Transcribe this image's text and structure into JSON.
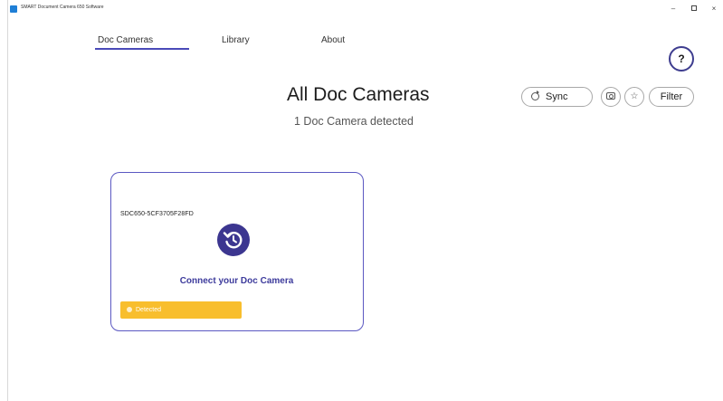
{
  "window": {
    "title": "SMART Document Camera 650 Software",
    "minimize": "–",
    "close": "×"
  },
  "nav": {
    "tabs": [
      {
        "label": "Doc Cameras",
        "active": true
      },
      {
        "label": "Library",
        "active": false
      },
      {
        "label": "About",
        "active": false
      }
    ]
  },
  "help": {
    "label": "?"
  },
  "header": {
    "title": "All Doc Cameras",
    "subtitle": "1  Doc Camera detected"
  },
  "toolbar": {
    "sync_label": "Sync",
    "filter_label": "Filter",
    "star_glyph": "☆"
  },
  "camera_card": {
    "device_id": "SDC650-5CF3705F28FD",
    "action_label": "Connect your Doc Camera",
    "status_label": "Detected",
    "status_color": "#f8be2d"
  },
  "colors": {
    "accent": "#4a4ab8",
    "connect_icon_bg": "#3c3690"
  }
}
